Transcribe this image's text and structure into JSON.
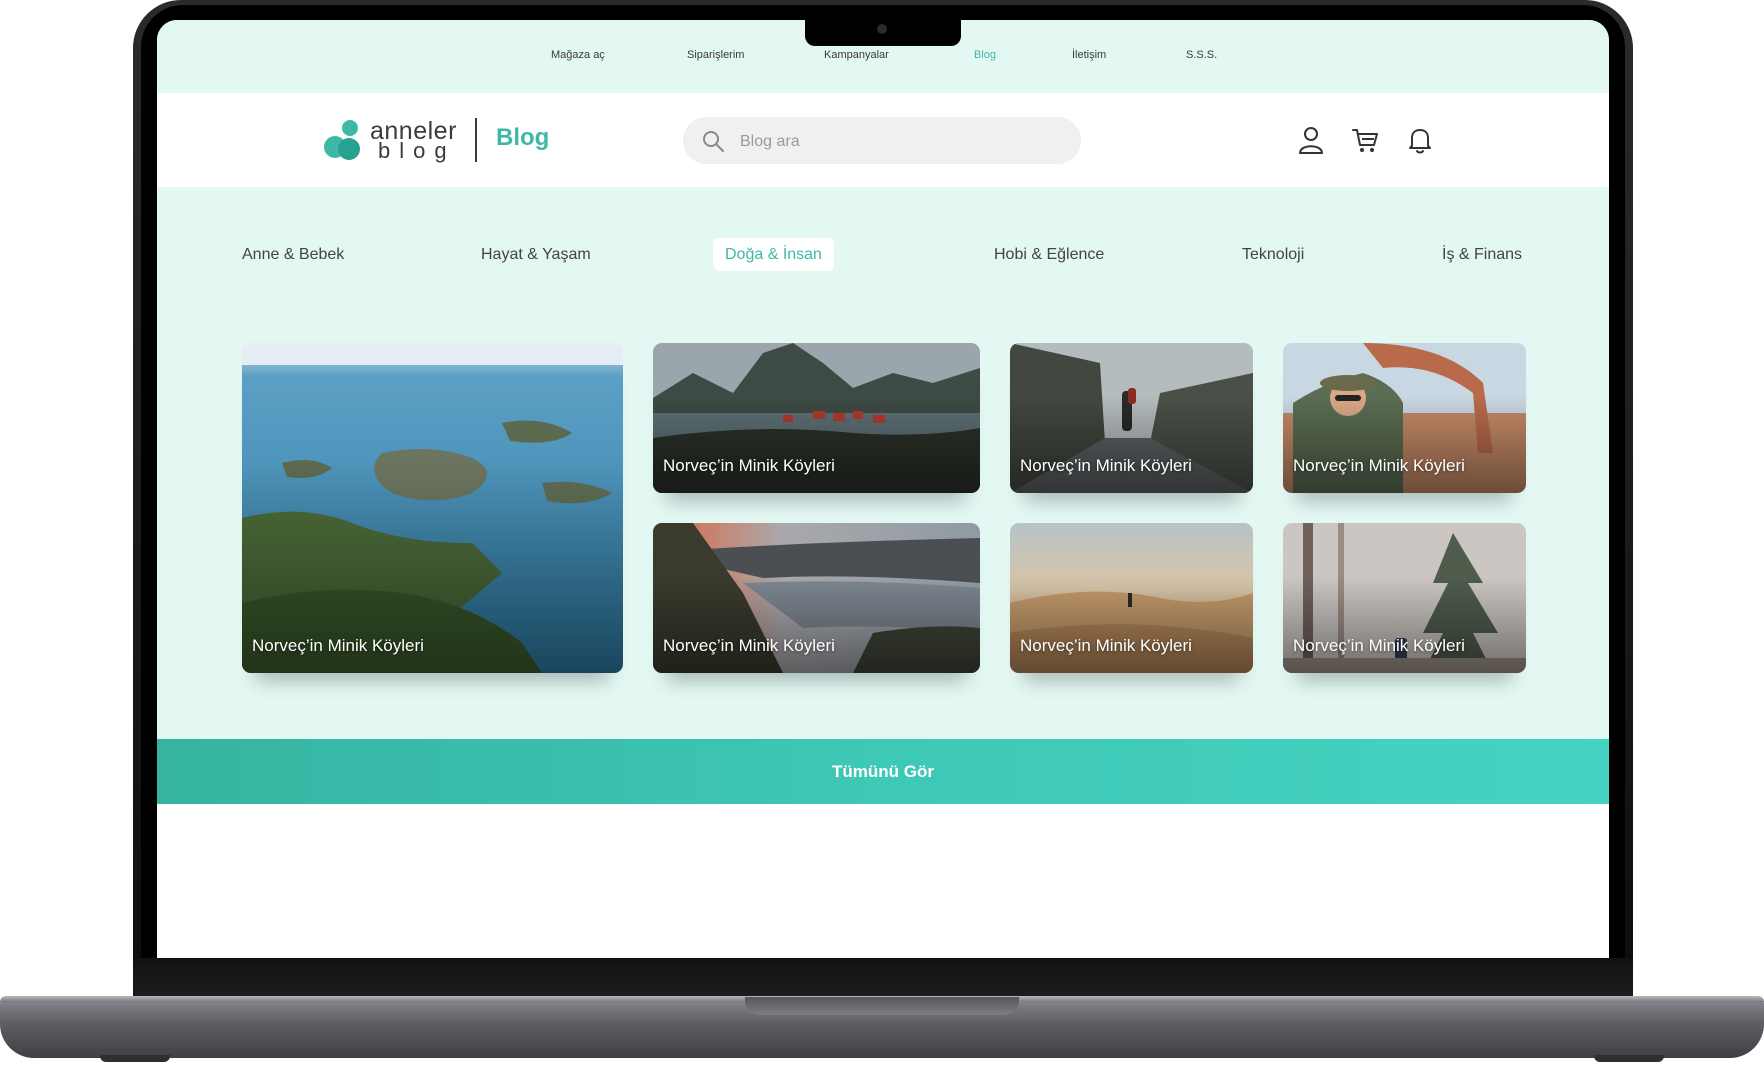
{
  "topbar": {
    "links": [
      {
        "label": "Mağaza aç"
      },
      {
        "label": "Siparişlerim"
      },
      {
        "label": "Kampanyalar"
      },
      {
        "label": "Blog",
        "active": true
      },
      {
        "label": "İletişim"
      },
      {
        "label": "S.S.S."
      }
    ]
  },
  "header": {
    "logo_word1": "anneler",
    "logo_word2": "blog",
    "section_title": "Blog",
    "search_placeholder": "Blog ara",
    "icons": [
      "user-icon",
      "cart-icon",
      "bell-icon"
    ]
  },
  "categories": [
    {
      "label": "Anne & Bebek"
    },
    {
      "label": "Hayat & Yaşam"
    },
    {
      "label": "Doğa & İnsan",
      "active": true
    },
    {
      "label": "Hobi & Eğlence"
    },
    {
      "label": "Teknoloji"
    },
    {
      "label": "İş & Finans"
    }
  ],
  "cards": [
    {
      "title": "Norveç’in Minik Köyleri"
    },
    {
      "title": "Norveç’in Minik Köyleri"
    },
    {
      "title": "Norveç’in Minik Köyleri"
    },
    {
      "title": "Norveç’in Minik Köyleri"
    },
    {
      "title": "Norveç’in Minik Köyleri"
    },
    {
      "title": "Norveç’in Minik Köyleri"
    },
    {
      "title": "Norveç’in Minik Köyleri"
    }
  ],
  "see_all_label": "Tümünü Gör",
  "colors": {
    "accent": "#3fb9a7",
    "mint_background": "#e3f7f3",
    "see_all_bar": "#3ec8b6"
  }
}
